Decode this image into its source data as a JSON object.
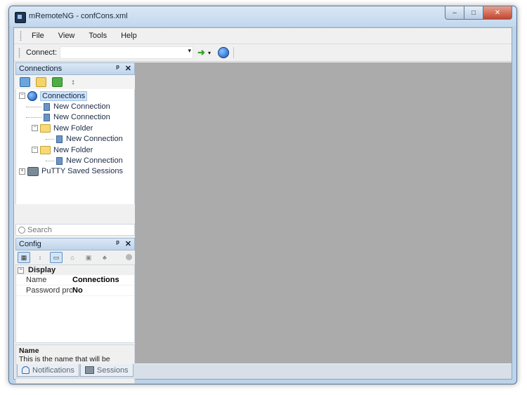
{
  "window": {
    "title": "mRemoteNG - confCons.xml",
    "controls": {
      "minimize": "–",
      "maximize": "□",
      "close": "✕"
    }
  },
  "menu": {
    "items": [
      "File",
      "View",
      "Tools",
      "Help"
    ]
  },
  "toolbar": {
    "connect_label": "Connect:",
    "connect_value": "",
    "go_icon": "green-arrow-icon",
    "globe_icon": "globe-icon"
  },
  "connections_panel": {
    "title": "Connections",
    "pin": "ᵖ",
    "close": "✕",
    "tree": [
      {
        "label": "Connections",
        "type": "root",
        "expander": "−",
        "indent": 0
      },
      {
        "label": "New Connection",
        "type": "connection",
        "indent": 1
      },
      {
        "label": "New Connection",
        "type": "connection",
        "indent": 1
      },
      {
        "label": "New Folder",
        "type": "folder",
        "expander": "−",
        "indent": 1
      },
      {
        "label": "New Connection",
        "type": "connection",
        "indent": 2
      },
      {
        "label": "New Folder",
        "type": "folder",
        "expander": "−",
        "indent": 1
      },
      {
        "label": "New Connection",
        "type": "connection",
        "indent": 2
      },
      {
        "label": "PuTTY Saved Sessions",
        "type": "putty",
        "expander": "+",
        "indent": 0
      }
    ],
    "search_placeholder": "Search"
  },
  "config_panel": {
    "title": "Config",
    "pin": "ᵖ",
    "close": "✕",
    "category": "Display",
    "properties": [
      {
        "name": "Name",
        "value": "Connections"
      },
      {
        "name": "Password pro",
        "value": "No"
      }
    ],
    "description_title": "Name",
    "description_text": "This is the name that will be displayed in the connections tree."
  },
  "bottom_tabs": [
    {
      "label": "Notifications"
    },
    {
      "label": "Sessions"
    }
  ]
}
